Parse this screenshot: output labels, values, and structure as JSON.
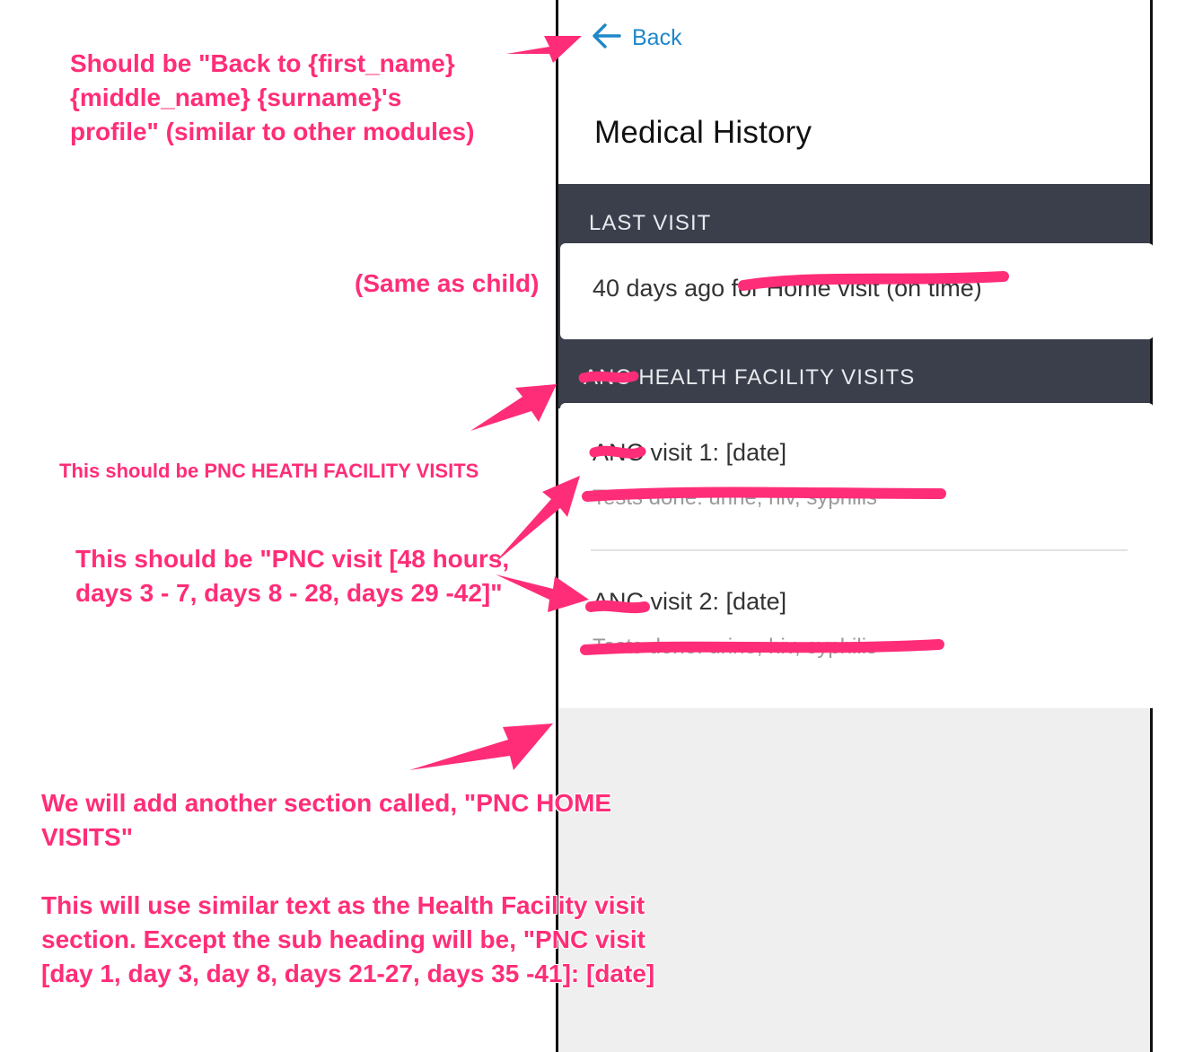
{
  "colors": {
    "annotation": "#ff2d78",
    "section_bar": "#3a3f4b",
    "link": "#1e88c9",
    "empty_area": "#efefef"
  },
  "app": {
    "back": {
      "icon": "arrow-left-icon",
      "label": "Back"
    },
    "title": "Medical History",
    "last_visit": {
      "heading": "LAST VISIT",
      "text": "40 days ago",
      "struck_text": "for Home visit (on time)"
    },
    "facility_visits": {
      "heading_struck": "ANC",
      "heading": "HEALTH FACILITY VISITS",
      "visits": [
        {
          "struck_prefix": "ANC",
          "title": "visit 1: [date]",
          "struck_subtitle": "Tests done: urine, hiv, syphilis"
        },
        {
          "struck_prefix": "ANC",
          "title": "visit 2: [date]",
          "struck_subtitle": "Tests done: urine, hiv, syphilis"
        }
      ]
    }
  },
  "annotations": {
    "back": "Should be \"Back to {first_name} {middle_name} {surname}'s profile\" (similar to other modules)",
    "last_visit": "(Same as child)",
    "facility_heading": "This should be PNC HEATH FACILITY VISITS",
    "visit_title": "This should be \"PNC visit [48 hours, days 3 - 7, days 8 - 28, days 29 -42]\"",
    "home_visits_p1": "We will add another section called, \"PNC HOME VISITS\"",
    "home_visits_p2": "This will use similar text as the Health Facility visit section. Except the sub heading will be, \"PNC visit [day 1, day 3, day 8,  days 21-27, days 35 -41]: [date]"
  }
}
